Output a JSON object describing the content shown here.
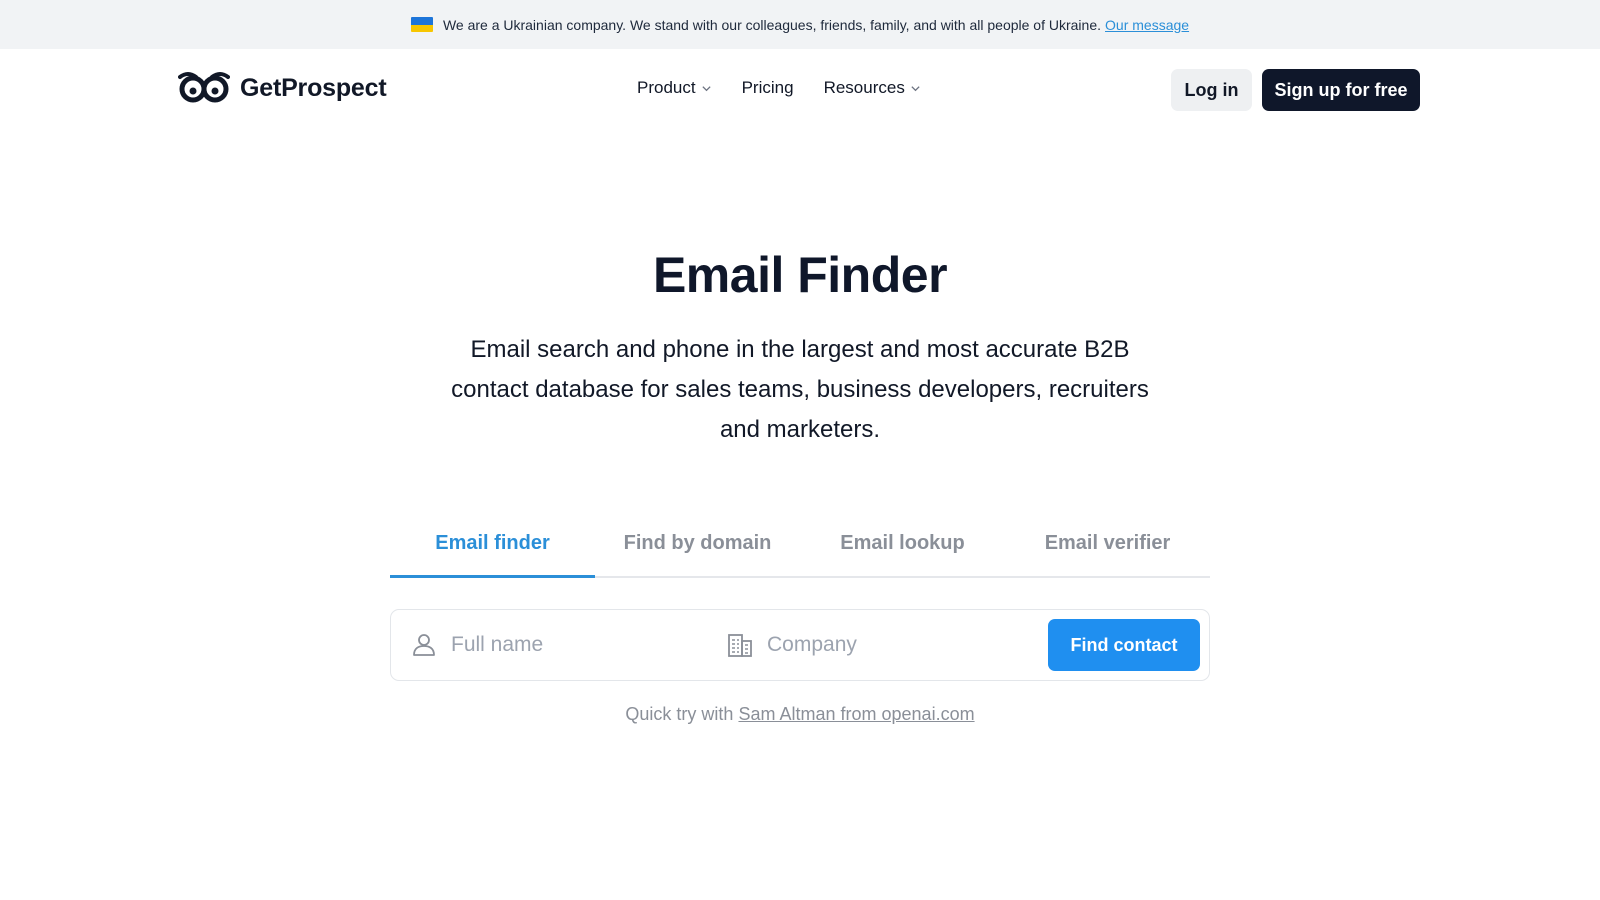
{
  "banner": {
    "message": "We are a Ukrainian company. We stand with our colleagues, friends, family, and with all people of Ukraine.",
    "link_label": "Our message",
    "flag_icon": "ukraine-flag-icon"
  },
  "header": {
    "logo_text": "GetProspect",
    "logo_icon": "owl-eyes-logo-icon",
    "menu": [
      {
        "label": "Product",
        "has_dropdown": true
      },
      {
        "label": "Pricing",
        "has_dropdown": false
      },
      {
        "label": "Resources",
        "has_dropdown": true
      }
    ],
    "login_label": "Log in",
    "signup_label": "Sign up for free"
  },
  "hero": {
    "title": "Email Finder",
    "subtitle": "Email search and phone in the largest and most accurate B2B contact database for sales teams, business developers, recruiters and marketers."
  },
  "tabs": [
    {
      "label": "Email finder",
      "active": true
    },
    {
      "label": "Find by domain",
      "active": false
    },
    {
      "label": "Email lookup",
      "active": false
    },
    {
      "label": "Email verifier",
      "active": false
    }
  ],
  "search": {
    "name_placeholder": "Full name",
    "name_icon": "person-icon",
    "company_placeholder": "Company",
    "company_icon": "building-icon",
    "button_label": "Find contact"
  },
  "quick_try": {
    "prefix": "Quick try with",
    "link_label": "Sam Altman from openai.com"
  },
  "colors": {
    "accent": "#2b8fd8",
    "button_blue": "#1f8ff0",
    "dark": "#0f172a",
    "banner_bg": "#f1f3f5"
  }
}
